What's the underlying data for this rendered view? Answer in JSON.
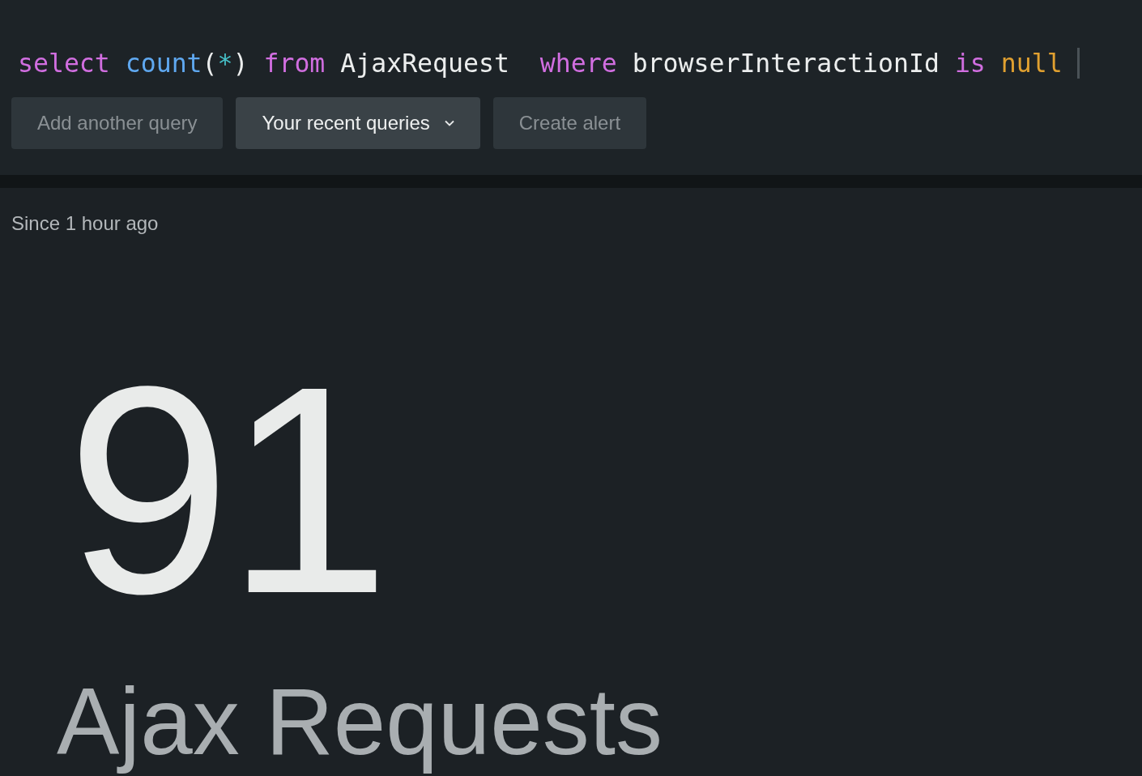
{
  "query": {
    "tokens": [
      {
        "text": "select ",
        "kind": "keyword"
      },
      {
        "text": "count",
        "kind": "function"
      },
      {
        "text": "(",
        "kind": "plain"
      },
      {
        "text": "*",
        "kind": "operator"
      },
      {
        "text": ") ",
        "kind": "plain"
      },
      {
        "text": "from",
        "kind": "keyword"
      },
      {
        "text": " AjaxRequest  ",
        "kind": "plain"
      },
      {
        "text": "where",
        "kind": "keyword"
      },
      {
        "text": " browserInteractionId ",
        "kind": "plain"
      },
      {
        "text": "is ",
        "kind": "keyword"
      },
      {
        "text": "null",
        "kind": "literal"
      }
    ]
  },
  "buttons": [
    {
      "label": "Add another query",
      "disabled": true,
      "dropdown": false
    },
    {
      "label": "Your recent queries",
      "disabled": false,
      "dropdown": true
    },
    {
      "label": "Create alert",
      "disabled": true,
      "dropdown": false
    }
  ],
  "result": {
    "time_range": "Since 1 hour ago",
    "value": "91",
    "label": "Ajax Requests"
  }
}
